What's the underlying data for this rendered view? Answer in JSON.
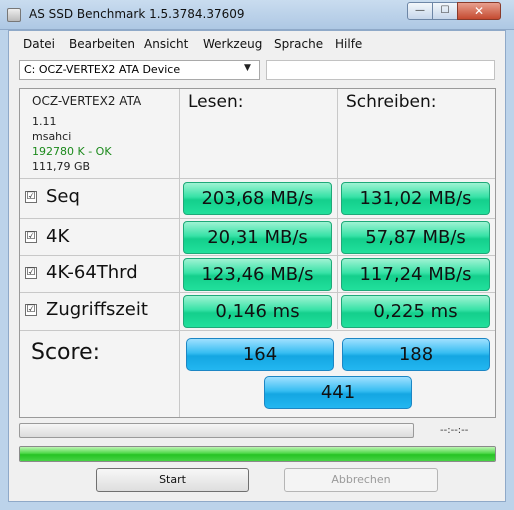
{
  "window": {
    "title": "AS SSD Benchmark 1.5.3784.37609",
    "minimize": "—",
    "maximize": "☐",
    "close": "✕"
  },
  "menu": [
    "Datei",
    "Bearbeiten",
    "Ansicht",
    "Werkzeug",
    "Sprache",
    "Hilfe"
  ],
  "device": {
    "selected": "C: OCZ-VERTEX2 ATA Device",
    "name": "OCZ-VERTEX2 ATA",
    "firmware": "1.11",
    "driver": "msahci",
    "alignment": "192780 K - OK",
    "capacity": "111,79 GB",
    "alignment_color": "#1c8a1c"
  },
  "headers": {
    "read": "Lesen:",
    "write": "Schreiben:"
  },
  "rows": [
    {
      "label": "Seq",
      "checked": "☑",
      "read": "203,68 MB/s",
      "write": "131,02 MB/s"
    },
    {
      "label": "4K",
      "checked": "☑",
      "read": "20,31 MB/s",
      "write": "57,87 MB/s"
    },
    {
      "label": "4K-64Thrd",
      "checked": "☑",
      "read": "123,46 MB/s",
      "write": "117,24 MB/s"
    },
    {
      "label": "Zugriffszeit",
      "checked": "☑",
      "read": "0,146 ms",
      "write": "0,225 ms"
    }
  ],
  "score": {
    "label": "Score:",
    "read": "164",
    "write": "188",
    "total": "441"
  },
  "progress": {
    "elapsed": "--:--:--",
    "upper_fraction": 0,
    "lower_fraction": 1.0
  },
  "buttons": {
    "start": "Start",
    "abort": "Abbrechen"
  }
}
